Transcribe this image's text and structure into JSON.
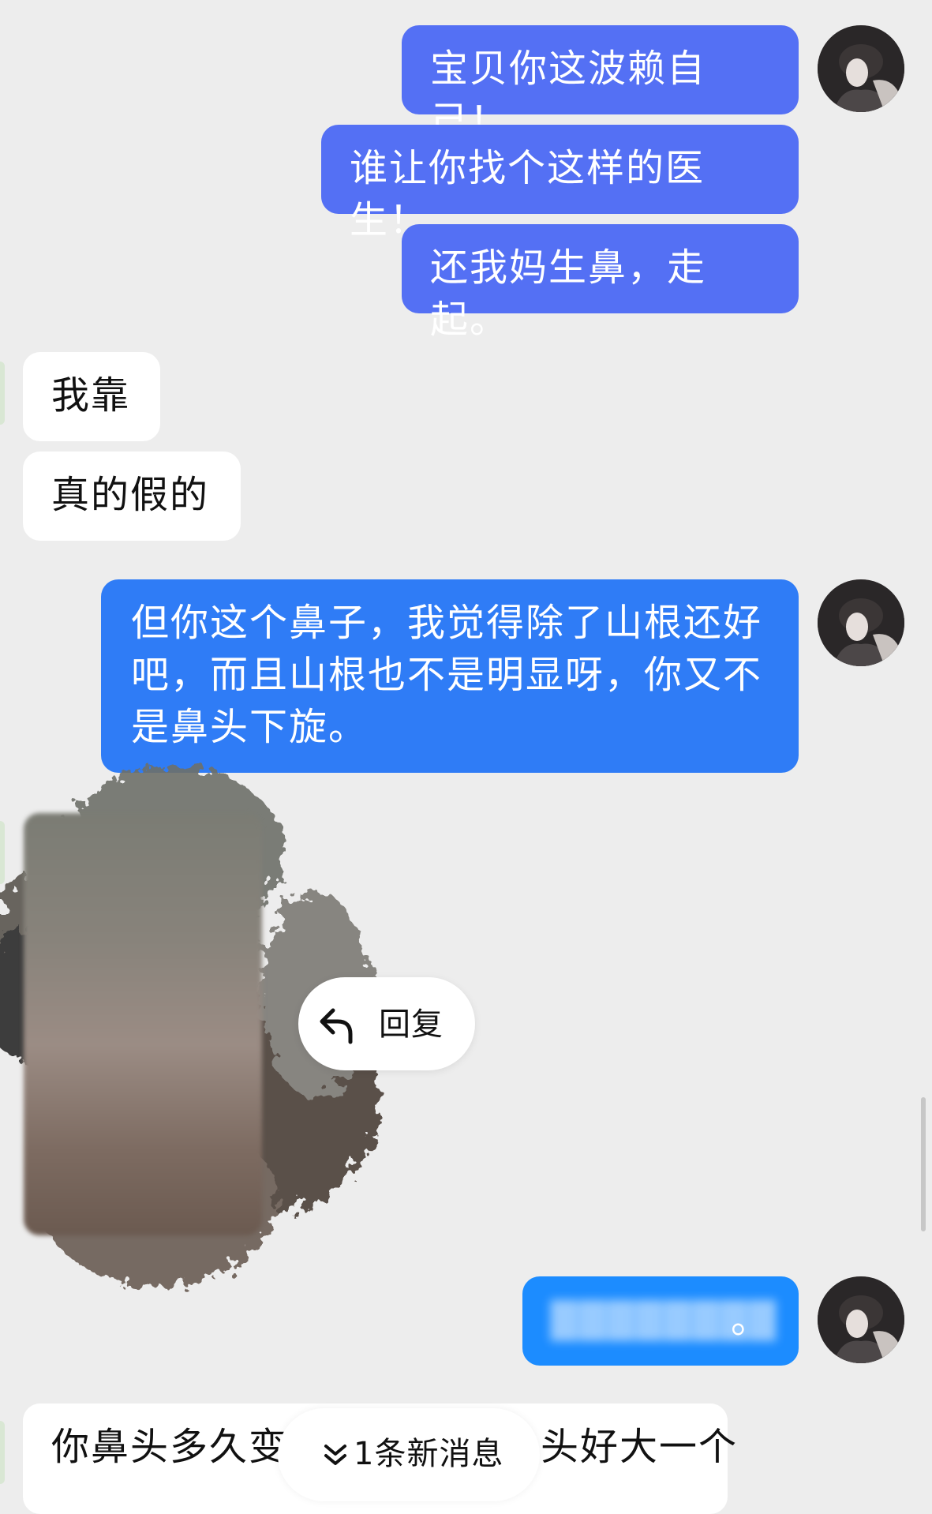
{
  "messages": [
    {
      "side": "out",
      "text": "宝贝你这波赖自己！"
    },
    {
      "side": "out",
      "text": "谁让你找个这样的医生！"
    },
    {
      "side": "out",
      "text": "还我妈生鼻，走起。"
    },
    {
      "side": "in",
      "text": "我靠"
    },
    {
      "side": "in",
      "text": "真的假的"
    },
    {
      "side": "out",
      "text": "但你这个鼻子，我觉得除了山根还好吧，而且山根也不是明显呀，你又不是鼻头下旋。"
    },
    {
      "side": "in",
      "type": "image"
    },
    {
      "side": "out",
      "text": "。"
    },
    {
      "side": "in",
      "text": "你鼻头多久变",
      "text_suffix": "头好大一个"
    }
  ],
  "context_menu": {
    "reply_label": "回复",
    "reply_icon": "reply-arrow-icon"
  },
  "new_message_badge": {
    "label": "1条新消息",
    "icon": "double-chevron-down-icon"
  },
  "colors": {
    "background": "#ededed",
    "outgoing_bubble": "#5470f4",
    "incoming_bubble": "#ffffff"
  }
}
